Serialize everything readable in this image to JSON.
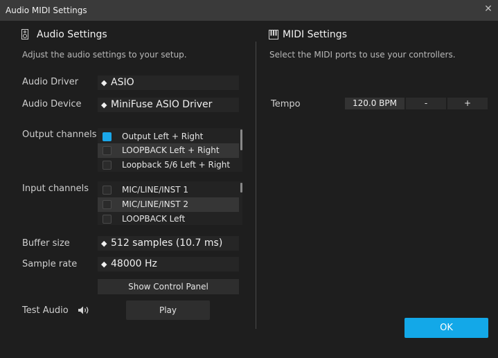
{
  "window": {
    "title": "Audio MIDI Settings",
    "close_icon": "close-icon"
  },
  "audio": {
    "title": "Audio Settings",
    "description": "Adjust the audio settings to your setup.",
    "icon": "speaker-icon",
    "driver": {
      "label": "Audio Driver",
      "value": "ASIO"
    },
    "device": {
      "label": "Audio Device",
      "value": "MiniFuse ASIO Driver"
    },
    "output_channels": {
      "label": "Output channels",
      "items": [
        {
          "label": "Output Left + Right",
          "checked": true
        },
        {
          "label": "LOOPBACK Left + Right",
          "checked": false
        },
        {
          "label": "Loopback 5/6 Left + Right",
          "checked": false
        }
      ]
    },
    "input_channels": {
      "label": "Input channels",
      "items": [
        {
          "label": "MIC/LINE/INST 1",
          "checked": false
        },
        {
          "label": "MIC/LINE/INST 2",
          "checked": false
        },
        {
          "label": "LOOPBACK Left",
          "checked": false
        }
      ]
    },
    "buffer_size": {
      "label": "Buffer size",
      "value": "512 samples (10.7 ms)"
    },
    "sample_rate": {
      "label": "Sample rate",
      "value": "48000 Hz"
    },
    "control_panel_button": "Show Control Panel",
    "test_audio": {
      "label": "Test Audio",
      "button": "Play",
      "icon": "volume-icon"
    }
  },
  "midi": {
    "title": "MIDI Settings",
    "description": "Select the MIDI ports to use your controllers.",
    "icon": "piano-keys-icon",
    "tempo": {
      "label": "Tempo",
      "value": "120.0 BPM",
      "decrement": "-",
      "increment": "+"
    }
  },
  "ok_button": "OK",
  "colors": {
    "accent": "#13a8e8",
    "background": "#1e1e1e",
    "titlebar": "#3a3a3a"
  }
}
